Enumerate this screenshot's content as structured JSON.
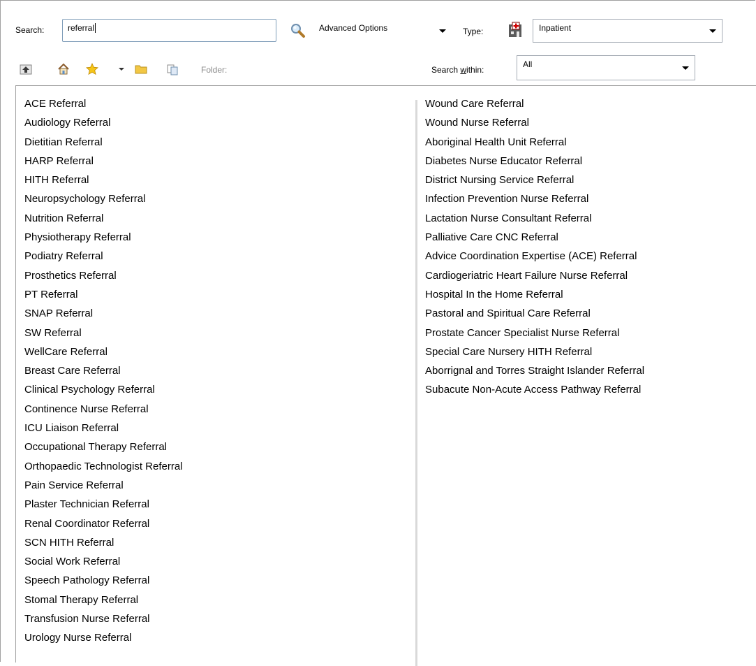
{
  "search": {
    "label": "Search:",
    "value": "referral"
  },
  "advanced_options": {
    "label": "Advanced Options"
  },
  "type": {
    "label": "Type:",
    "selected": "Inpatient"
  },
  "toolbar": {
    "folder_label": "Folder:"
  },
  "search_within": {
    "label_pre": "Search ",
    "label_accel": "w",
    "label_post": "ithin:",
    "selected": "All"
  },
  "results": {
    "left_column": [
      "ACE Referral",
      "Audiology Referral",
      "Dietitian Referral",
      "HARP Referral",
      "HITH Referral",
      "Neuropsychology Referral",
      "Nutrition Referral",
      "Physiotherapy Referral",
      "Podiatry Referral",
      "Prosthetics Referral",
      "PT Referral",
      "SNAP Referral",
      "SW Referral",
      "WellCare Referral",
      "Breast Care Referral",
      "Clinical Psychology Referral",
      "Continence Nurse Referral",
      "ICU Liaison Referral",
      "Occupational Therapy Referral",
      "Orthopaedic Technologist Referral",
      "Pain Service Referral",
      "Plaster Technician Referral",
      "Renal Coordinator Referral",
      "SCN HITH Referral",
      "Social Work Referral",
      "Speech Pathology Referral",
      "Stomal Therapy Referral",
      "Transfusion Nurse Referral",
      "Urology Nurse Referral"
    ],
    "right_column": [
      "Wound Care Referral",
      "Wound Nurse Referral",
      "Aboriginal Health Unit Referral",
      "Diabetes Nurse Educator Referral",
      "District Nursing Service Referral",
      "Infection Prevention Nurse Referral",
      "Lactation Nurse Consultant Referral",
      "Palliative Care CNC Referral",
      "Advice Coordination Expertise (ACE) Referral",
      "Cardiogeriatric Heart Failure Nurse Referral",
      "Hospital In the Home Referral",
      "Pastoral and Spiritual Care Referral",
      "Prostate Cancer Specialist Nurse Referral",
      "Special Care Nursery HITH Referral",
      "Aborrignal and Torres Straight Islander Referral",
      "Subacute Non-Acute Access Pathway Referral"
    ]
  },
  "colors": {
    "border": "#a0a0a0",
    "input_border": "#7f9db9",
    "disabled_text": "#8a8a8a",
    "column_divider": "#d9d9d9"
  }
}
